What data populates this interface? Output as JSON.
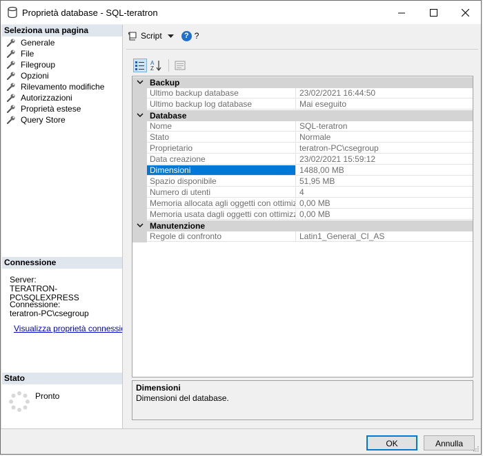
{
  "window": {
    "title": "Proprietà database - SQL-teratron"
  },
  "left": {
    "select_page_header": "Seleziona una pagina",
    "pages": [
      {
        "label": "Generale"
      },
      {
        "label": "File"
      },
      {
        "label": "Filegroup"
      },
      {
        "label": "Opzioni"
      },
      {
        "label": "Rilevamento modifiche"
      },
      {
        "label": "Autorizzazioni"
      },
      {
        "label": "Proprietà estese"
      },
      {
        "label": "Query Store"
      }
    ],
    "connection_header": "Connessione",
    "server_label": "Server:",
    "server_value": "TERATRON-PC\\SQLEXPRESS",
    "connection_label": "Connessione:",
    "connection_value": "teratron-PC\\csegroup",
    "connection_link": "Visualizza proprietà connessione",
    "status_header": "Stato",
    "status_value": "Pronto"
  },
  "toolbar": {
    "script_label": "Script",
    "help_q": "?"
  },
  "grid": {
    "categories": [
      {
        "label": "Backup",
        "rows": [
          {
            "name": "Ultimo backup database",
            "value": "23/02/2021 16:44:50"
          },
          {
            "name": "Ultimo backup log database",
            "value": "Mai eseguito"
          }
        ]
      },
      {
        "label": "Database",
        "rows": [
          {
            "name": "Nome",
            "value": "SQL-teratron"
          },
          {
            "name": "Stato",
            "value": "Normale"
          },
          {
            "name": "Proprietario",
            "value": "teratron-PC\\csegroup"
          },
          {
            "name": "Data creazione",
            "value": "23/02/2021 15:59:12"
          },
          {
            "name": "Dimensioni",
            "value": "1488,00 MB"
          },
          {
            "name": "Spazio disponibile",
            "value": "51,95 MB"
          },
          {
            "name": "Numero di utenti",
            "value": "4"
          },
          {
            "name": "Memoria allocata agli oggetti con ottimizzazione per la memoria",
            "value": "0,00 MB"
          },
          {
            "name": "Memoria usata dagli oggetti con ottimizzazione per la memoria",
            "value": "0,00 MB"
          }
        ]
      },
      {
        "label": "Manutenzione",
        "rows": [
          {
            "name": "Regole di confronto",
            "value": "Latin1_General_CI_AS"
          }
        ]
      }
    ]
  },
  "description": {
    "title": "Dimensioni",
    "text": "Dimensioni del database."
  },
  "buttons": {
    "ok": "OK",
    "cancel": "Annulla"
  },
  "colors": {
    "selection": "#0078d7",
    "category_bg": "#d4d4d4",
    "section_header_bg": "#dfe6ee",
    "link": "#0000cc"
  }
}
